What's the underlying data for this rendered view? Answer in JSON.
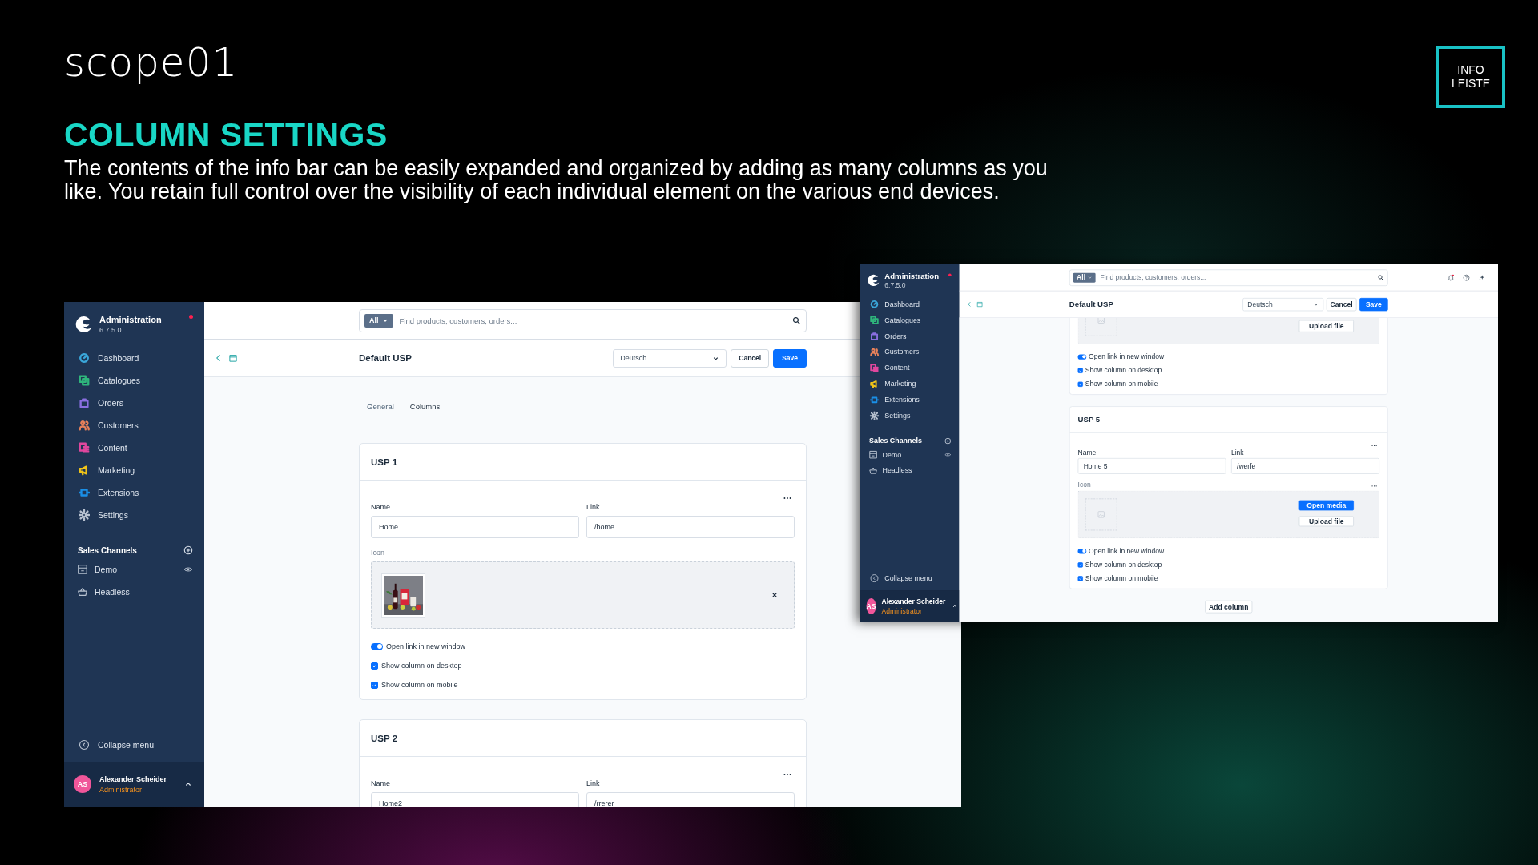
{
  "logo": "scope01",
  "badge": "INFO LEISTE",
  "title": "COLUMN SETTINGS",
  "description": "The contents of the info bar can be easily expanded and organized by adding as many columns as you like. You retain full control over the visibility of each individual element on the various end devices.",
  "windows": [
    {
      "scrolled_to_end": false,
      "sidebar": {
        "app_name": "Administration",
        "version": "6.7.5.0",
        "alert_dot": true,
        "items": [
          {
            "label": "Dashboard",
            "color": "#3aa6d9"
          },
          {
            "label": "Catalogues",
            "color": "#2fb67c"
          },
          {
            "label": "Orders",
            "color": "#8a6fe0"
          },
          {
            "label": "Customers",
            "color": "#e8815a"
          },
          {
            "label": "Content",
            "color": "#e0479e"
          },
          {
            "label": "Marketing",
            "color": "#f0c419"
          },
          {
            "label": "Extensions",
            "color": "#1a8fe6"
          },
          {
            "label": "Settings",
            "color": "#b8c2d0"
          }
        ],
        "channels_heading": "Sales Channels",
        "channels": [
          {
            "label": "Demo",
            "preview": true
          },
          {
            "label": "Headless",
            "preview": false
          }
        ],
        "collapse": "Collapse menu",
        "user": {
          "initials": "AS",
          "name": "Alexander Scheider",
          "role": "Administrator"
        }
      },
      "search": {
        "filter": "All",
        "placeholder": "Find products, customers, orders..."
      },
      "header": {
        "title": "Default USP",
        "language": "Deutsch",
        "cancel": "Cancel",
        "save": "Save"
      },
      "tabs": [
        {
          "label": "General",
          "selected": false
        },
        {
          "label": "Columns",
          "selected": true
        }
      ],
      "cards": [
        {
          "title": "USP 1",
          "menu": true,
          "name_label": "Name",
          "name": "Home",
          "link_label": "Link",
          "link": "/home",
          "icon": {
            "label": "Icon",
            "menu": false,
            "kind": "picture"
          },
          "options": [
            {
              "kind": "toggle",
              "label": "Open link in new window",
              "checked": true
            },
            {
              "kind": "checkbox",
              "label": "Show column on desktop",
              "checked": true
            },
            {
              "kind": "checkbox",
              "label": "Show column on mobile",
              "checked": true
            }
          ]
        },
        {
          "title": "USP 2",
          "menu": true,
          "name_label": "Name",
          "name": "Home2",
          "link_label": "Link",
          "link": "/rrerer"
        }
      ]
    },
    {
      "header_icons": true,
      "scrolled_to_end": true,
      "sidebar": {
        "app_name": "Administration",
        "version": "6.7.5.0",
        "alert_dot": true,
        "items": [
          {
            "label": "Dashboard",
            "color": "#3aa6d9"
          },
          {
            "label": "Catalogues",
            "color": "#2fb67c"
          },
          {
            "label": "Orders",
            "color": "#8a6fe0"
          },
          {
            "label": "Customers",
            "color": "#e8815a"
          },
          {
            "label": "Content",
            "color": "#e0479e"
          },
          {
            "label": "Marketing",
            "color": "#f0c419"
          },
          {
            "label": "Extensions",
            "color": "#1a8fe6"
          },
          {
            "label": "Settings",
            "color": "#b8c2d0"
          }
        ],
        "channels_heading": "Sales Channels",
        "channels": [
          {
            "label": "Demo",
            "preview": true
          },
          {
            "label": "Headless",
            "preview": false
          }
        ],
        "collapse": "Collapse menu",
        "user": {
          "initials": "AS",
          "name": "Alexander Scheider",
          "role": "Administrator"
        }
      },
      "search": {
        "filter": "All",
        "placeholder": "Find products, customers, orders..."
      },
      "header": {
        "title": "Default USP",
        "language": "Deutsch",
        "cancel": "Cancel",
        "save": "Save"
      },
      "cards": [
        {
          "icon": {
            "kind": "empty",
            "buttons": [
              {
                "label": "Upload file",
                "primary": false
              }
            ]
          },
          "options": [
            {
              "kind": "toggle",
              "label": "Open link in new window",
              "checked": true
            },
            {
              "kind": "checkbox",
              "label": "Show column on desktop",
              "checked": true
            },
            {
              "kind": "checkbox",
              "label": "Show column on mobile",
              "checked": true
            }
          ]
        },
        {
          "title": "USP 5",
          "menu": true,
          "name_label": "Name",
          "name": "Home 5",
          "link_label": "Link",
          "link": "/werfe",
          "icon": {
            "label": "Icon",
            "menu": true,
            "kind": "empty",
            "buttons": [
              {
                "label": "Open media",
                "primary": true
              },
              {
                "label": "Upload file",
                "primary": false
              }
            ]
          },
          "options": [
            {
              "kind": "toggle",
              "label": "Open link in new window",
              "checked": true
            },
            {
              "kind": "checkbox",
              "label": "Show column on desktop",
              "checked": true
            },
            {
              "kind": "checkbox",
              "label": "Show column on mobile",
              "checked": true
            }
          ]
        }
      ],
      "add_column": "Add column"
    }
  ]
}
